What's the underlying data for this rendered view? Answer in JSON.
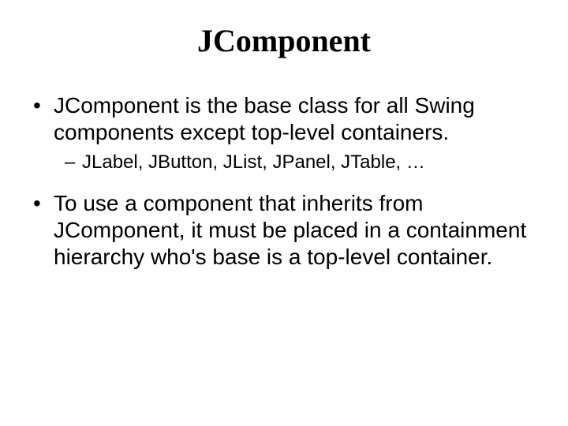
{
  "slide": {
    "title": "JComponent",
    "bullets": [
      {
        "level": 1,
        "text": "JComponent is the base class for all Swing components except top-level containers."
      },
      {
        "level": 2,
        "text": "JLabel, JButton, JList, JPanel, JTable, …"
      },
      {
        "level": 1,
        "text": "To use a component that inherits from JComponent, it must be placed in a containment hierarchy who's base is a top-level container."
      }
    ]
  }
}
